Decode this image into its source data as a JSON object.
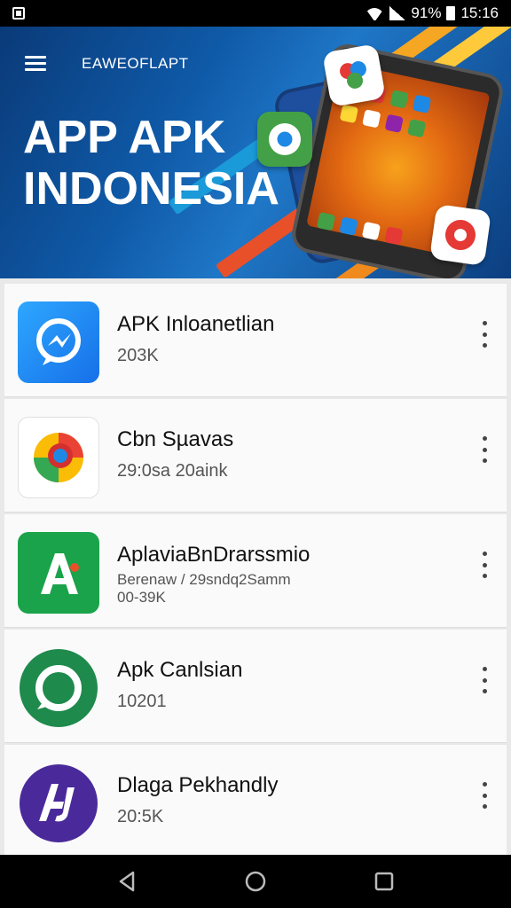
{
  "status_bar": {
    "battery": "91%",
    "time": "15:16",
    "icons": [
      "notification-icon",
      "wifi-icon",
      "signal-icon",
      "battery-icon"
    ]
  },
  "banner": {
    "menu_icon": "hamburger-menu-icon",
    "label": "EAWEOFLAPT",
    "title": "APP APK INDONESIA",
    "colors": {
      "background": "#0f5aa8",
      "accent": "#f5a623"
    }
  },
  "apps": [
    {
      "name": "APK Inloanetlian",
      "meta": "203K",
      "icon": "messenger-icon",
      "color": "#1a8cf0"
    },
    {
      "name": "Cbn Sµavas",
      "meta": "29:0sa 20aink",
      "icon": "chrome-icon",
      "color": "#ffffff"
    },
    {
      "name": "AplaviaBnDrarssmio",
      "meta": "Berenaw / 29sndq2Samm",
      "meta2": "00-39K",
      "icon": "a-letter-icon",
      "color": "#1aa34a"
    },
    {
      "name": "Apk Canlsian",
      "meta": "10201",
      "icon": "chat-bubble-icon",
      "color": "#1e8a4c"
    },
    {
      "name": "Dlaga Pekhandly",
      "meta": "20:5K",
      "icon": "aj-logo-icon",
      "color": "#4a2a9a"
    }
  ],
  "nav_bar": {
    "icons": [
      "back-icon",
      "home-icon",
      "recents-icon"
    ]
  }
}
